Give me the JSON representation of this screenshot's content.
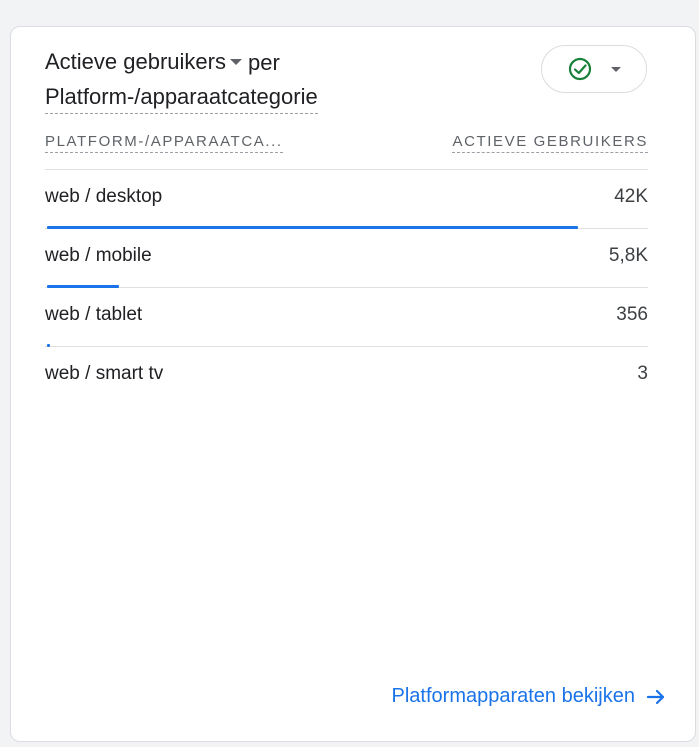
{
  "card": {
    "title": {
      "metric": "Actieve gebruikers",
      "connector": "per",
      "dimension": "Platform-/apparaatcategorie"
    },
    "status_icon": "check-circle-icon"
  },
  "table": {
    "headers": [
      "PLATFORM-/APPARAATCA...",
      "ACTIEVE GEBRUIKERS"
    ],
    "rows": [
      {
        "label": "web / desktop",
        "value": "42K",
        "share": 0.88
      },
      {
        "label": "web / mobile",
        "value": "5,8K",
        "share": 0.12
      },
      {
        "label": "web / tablet",
        "value": "356",
        "share": 0.005
      },
      {
        "label": "web / smart tv",
        "value": "3",
        "share": 0
      }
    ]
  },
  "footer": {
    "link_label": "Platformapparaten bekijken",
    "link_icon": "arrow-right-icon"
  },
  "colors": {
    "accent": "#1a73e8",
    "check": "#188038"
  }
}
